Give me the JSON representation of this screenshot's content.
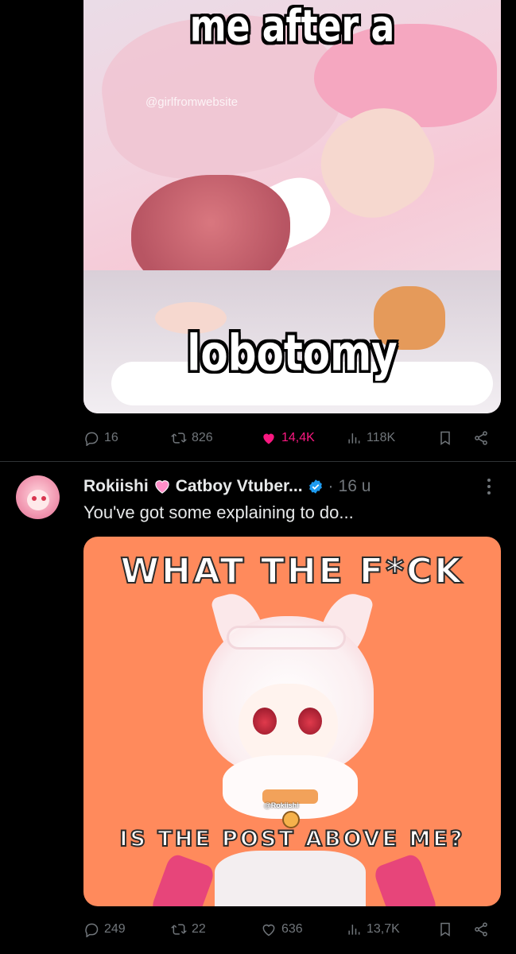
{
  "post1": {
    "image": {
      "caption_top": "me after a",
      "caption_bottom": "lobotomy",
      "watermark": "@girlfromwebsite"
    },
    "actions": {
      "replies": "16",
      "reposts": "826",
      "likes": "14,4K",
      "views": "118K"
    }
  },
  "post2": {
    "author_name": "Rokiishi",
    "author_name_rest": "Catboy Vtuber...",
    "separator": "·",
    "time": "16 u",
    "text": "You've got some explaining to do...",
    "image": {
      "text_top": "WHAT THE F*CK",
      "text_bottom": "IS THE POST ABOVE ME?",
      "collar_tag": "@Rokiishi"
    },
    "actions": {
      "replies": "249",
      "reposts": "22",
      "likes": "636",
      "views": "13,7K"
    }
  },
  "colors": {
    "background": "#000000",
    "muted": "#71767b",
    "text": "#e7e9ea",
    "like_active": "#f91880",
    "verified": "#1d9bf0",
    "meme_bg": "#ff8a5c"
  },
  "icons": [
    "reply-icon",
    "repost-icon",
    "like-icon",
    "views-icon",
    "bookmark-icon",
    "share-icon",
    "verified-badge-icon",
    "more-icon",
    "pink-heart-emoji"
  ]
}
